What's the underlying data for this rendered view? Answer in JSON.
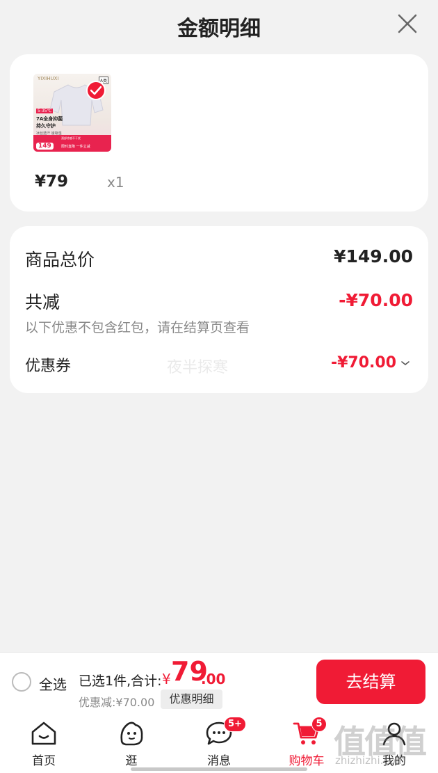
{
  "header": {
    "title": "金额明细"
  },
  "product": {
    "thumb": {
      "brand": "YIXIHUXI",
      "grade": "A类",
      "tag": "5-35℃",
      "line1": "7A全身抑菌",
      "line2": "持久守护",
      "line3": "冰丝透汗 速吸湿",
      "strip_top": "颈部凉感不干扰",
      "price": "149",
      "strip_text": "限时直降 一件立减"
    },
    "price": "¥79",
    "qty": "x1"
  },
  "summary": {
    "total_label": "商品总价",
    "total_value": "¥149.00",
    "reduce_label": "共减",
    "reduce_value": "-¥70.00",
    "note": "以下优惠不包含红包，请在结算页查看",
    "coupon_label": "优惠券",
    "coupon_value": "-¥70.00",
    "watermark": "夜半探寒"
  },
  "bottom": {
    "select_all": "全选",
    "selected": "已选1件,合计:",
    "currency": "¥",
    "total_int": "79",
    "total_dec": ".00",
    "discount": "优惠减:¥70.00",
    "detail_btn": "优惠明细",
    "checkout": "去结算"
  },
  "tabs": [
    {
      "label": "首页",
      "icon": "home-icon"
    },
    {
      "label": "逛",
      "icon": "explore-icon"
    },
    {
      "label": "消息",
      "icon": "message-icon",
      "badge": "5+"
    },
    {
      "label": "购物车",
      "icon": "cart-icon",
      "badge": "5",
      "active": true
    },
    {
      "label": "我的",
      "icon": "profile-icon"
    }
  ],
  "watermark_site": {
    "mark": "值值值",
    "url": "zhizhizhi.com"
  },
  "colors": {
    "accent": "#f01b35",
    "background": "#f2f2f2",
    "card": "#ffffff"
  }
}
